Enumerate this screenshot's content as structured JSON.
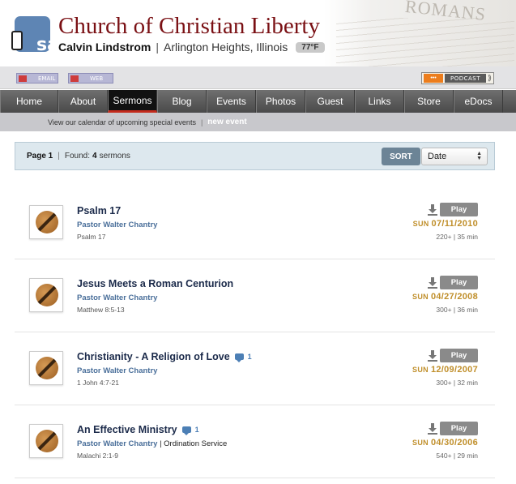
{
  "header": {
    "logo_text": "sa",
    "site_title": "Church of Christian Liberty",
    "pastor_name": "Calvin Lindstrom",
    "separator": "|",
    "location": "Arlington Heights, Illinois",
    "temperature": "77°F",
    "background_text": "ROMANS"
  },
  "subbar": {
    "email_label": "EMAIL",
    "web_label": "WEB",
    "podcast_badge": "•••",
    "podcast_label": "PODCAST",
    "podcast_arrow": "⟫"
  },
  "nav": {
    "items": [
      "Home",
      "About",
      "Sermons",
      "Blog",
      "Events",
      "Photos",
      "Guest",
      "Links",
      "Store",
      "eDocs"
    ],
    "active": "Sermons"
  },
  "calendar": {
    "text": "View our calendar of upcoming special events",
    "separator": "|",
    "link": "new event"
  },
  "toolbar": {
    "page_label": "Page 1",
    "separator": "|",
    "found_prefix": "Found:",
    "found_count": "4",
    "found_suffix": "sermons",
    "sort_label": "SORT",
    "sort_value": "Date"
  },
  "sermons": [
    {
      "title": "Psalm 17",
      "speaker": "Pastor Walter Chantry",
      "event": "",
      "reference": "Psalm 17",
      "day": "SUN",
      "date": "07/11/2010",
      "stats": "220+ | 35 min",
      "comments": "",
      "play": "Play"
    },
    {
      "title": "Jesus Meets a Roman Centurion",
      "speaker": "Pastor Walter Chantry",
      "event": "",
      "reference": "Matthew 8:5-13",
      "day": "SUN",
      "date": "04/27/2008",
      "stats": "300+ | 36 min",
      "comments": "",
      "play": "Play"
    },
    {
      "title": "Christianity - A Religion of Love",
      "speaker": "Pastor Walter Chantry",
      "event": "",
      "reference": "1 John 4:7-21",
      "day": "SUN",
      "date": "12/09/2007",
      "stats": "300+ | 32 min",
      "comments": "1",
      "play": "Play"
    },
    {
      "title": "An Effective Ministry",
      "speaker": "Pastor Walter Chantry",
      "event": "| Ordination Service",
      "reference": "Malachi 2:1-9",
      "day": "SUN",
      "date": "04/30/2006",
      "stats": "540+ | 29 min",
      "comments": "1",
      "play": "Play"
    }
  ],
  "colors": {
    "title_red": "#7a1014",
    "nav_active_underline": "#c32a1c",
    "date_gold": "#c08f2b",
    "speaker_blue": "#4a6f9a",
    "sort_button": "#6c8496"
  }
}
